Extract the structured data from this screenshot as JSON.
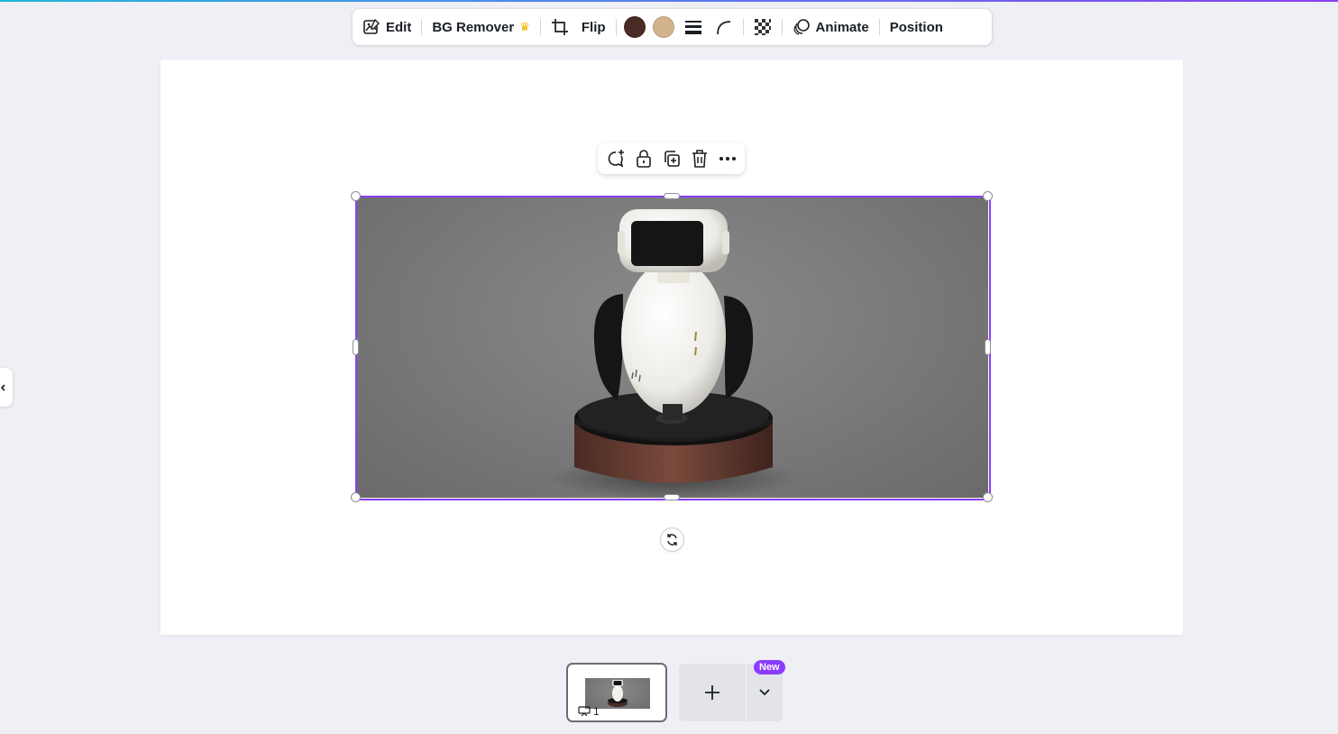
{
  "toolbar": {
    "edit_label": "Edit",
    "bg_remover_label": "BG Remover",
    "flip_label": "Flip",
    "animate_label": "Animate",
    "position_label": "Position",
    "swatches": [
      "#4a2a25",
      "#d2b48c"
    ]
  },
  "context_menu": {
    "icons": [
      "comment-add-icon",
      "unlock-icon",
      "duplicate-icon",
      "trash-icon",
      "more-icon"
    ]
  },
  "pages": {
    "current_page_number": "1",
    "new_badge": "New"
  },
  "colors": {
    "selection": "#8b3dff",
    "accent": "#8b3dff"
  }
}
